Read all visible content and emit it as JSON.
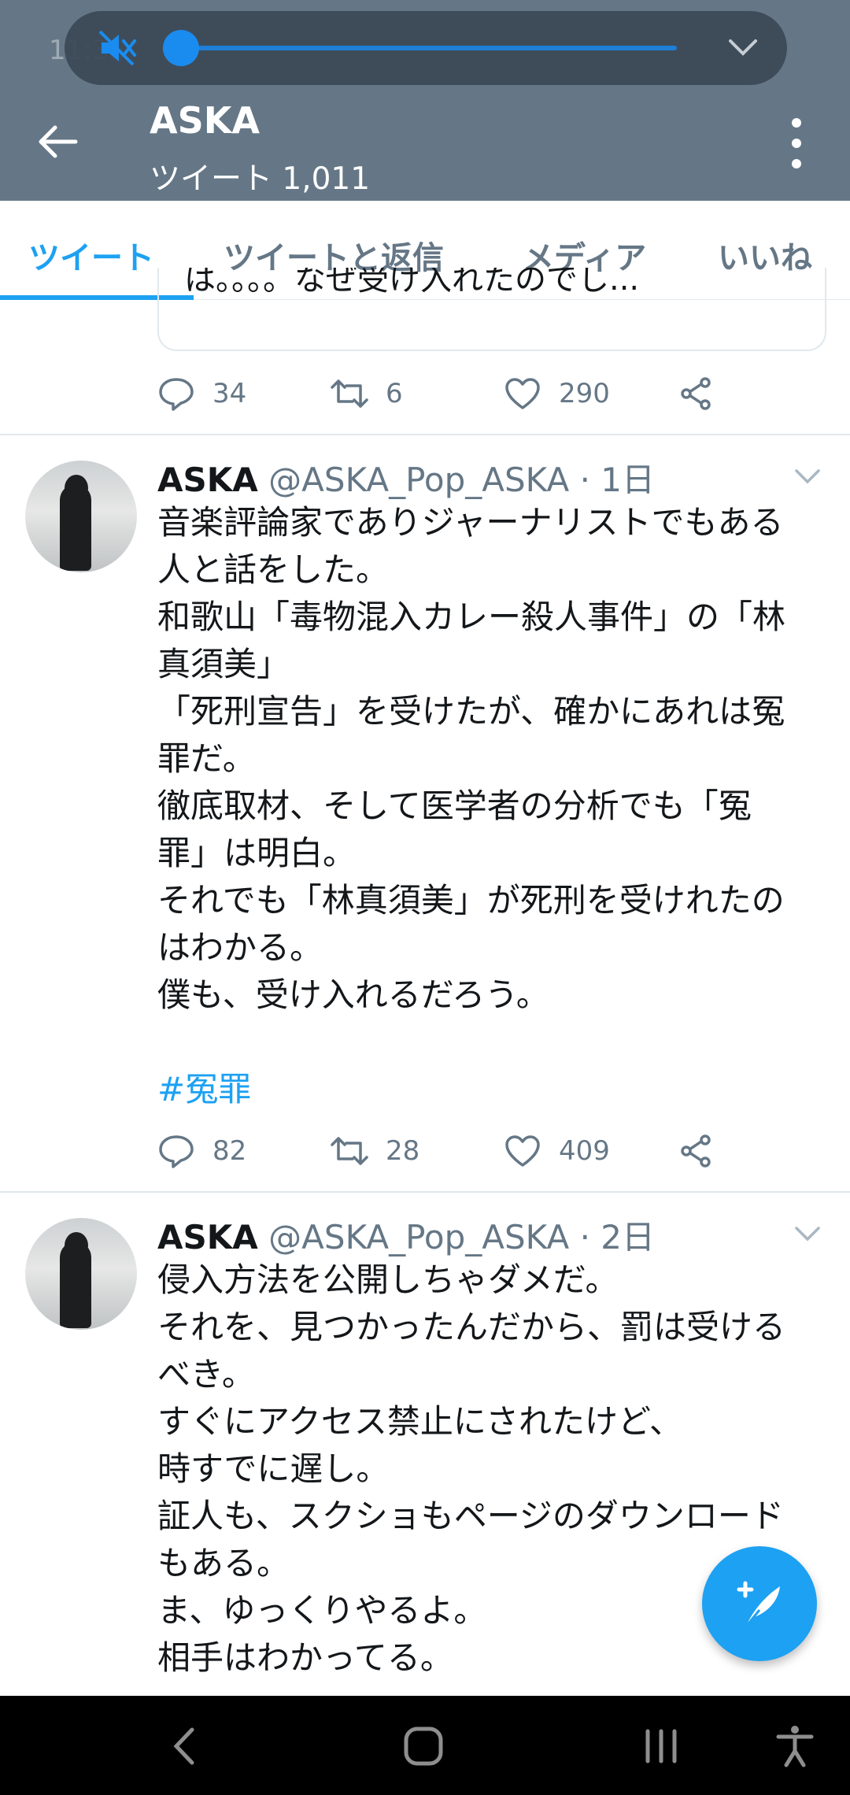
{
  "status": {
    "time": "11:35"
  },
  "header": {
    "title": "ASKA",
    "subtitle": "ツイート 1,011",
    "bg_color": "#657786"
  },
  "tabs": [
    {
      "label": "ツイート",
      "active": true
    },
    {
      "label": "ツイートと返信",
      "active": false
    },
    {
      "label": "メディア",
      "active": false
    },
    {
      "label": "いいね",
      "active": false
    }
  ],
  "accent_color": "#1da1f2",
  "quote_preview": {
    "text": "は。。。。なぜ受け入れたのでし..."
  },
  "prev_actions": {
    "replies": "34",
    "retweets": "6",
    "likes": "290"
  },
  "tweets": [
    {
      "name": "ASKA",
      "handle": "@ASKA_Pop_ASKA · 1日",
      "lines": [
        "音楽評論家でありジャーナリストでもある",
        "人と話をした。",
        "和歌山「毒物混入カレー殺人事件」の「林",
        "真須美」",
        "「死刑宣告」を受けたが、確かにあれは冤",
        "罪だ。",
        "徹底取材、そして医学者の分析でも「冤",
        "罪」は明白。",
        "それでも「林真須美」が死刑を受けれたの",
        "はわかる。",
        "僕も、受け入れるだろう。"
      ],
      "hashtag": "#冤罪",
      "replies": "82",
      "retweets": "28",
      "likes": "409"
    },
    {
      "name": "ASKA",
      "handle": "@ASKA_Pop_ASKA · 2日",
      "lines": [
        "侵入方法を公開しちゃダメだ。",
        "それを、見つかったんだから、罰は受ける",
        "べき。",
        "すぐにアクセス禁止にされたけど、",
        "時すでに遅し。",
        "証人も、スクショもページのダウンロード",
        "もある。",
        "ま、ゆっくりやるよ。",
        "相手はわかってる。"
      ]
    }
  ]
}
